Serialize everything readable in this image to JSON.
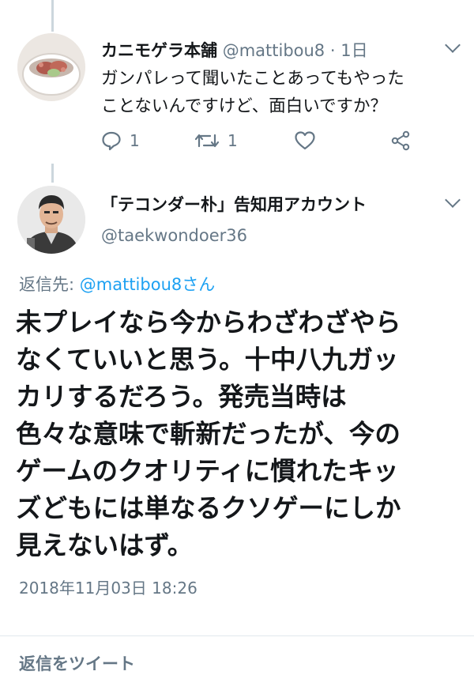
{
  "tweet1": {
    "name": "カニモゲラ本舗",
    "handle": "@mattibou8",
    "separator": " · ",
    "time": "1日",
    "text_line1": "ガンパレって聞いたことあってもやった",
    "text_line2": "ことないんですけど、面白いですか？",
    "reply_count": "1",
    "retweet_count": "1"
  },
  "tweet2": {
    "name": "「テコンダー朴」告知用アカウント",
    "handle": "@taekwondoer36",
    "reply_to_label": "返信先: ",
    "reply_to_handle": "@mattibou8さん",
    "lines": [
      "未プレイなら今からわざわざやら",
      "なくていいと思う。十中八九ガッ",
      "カリするだろう。発売当時は",
      "色々な意味で斬新だったが、今の",
      "ゲームのクオリティに慣れたキッ",
      "ズどもには単なるクソゲーにしか",
      "見えないはず。"
    ],
    "timestamp": "2018年11月03日 18:26"
  },
  "footer": {
    "reply_label": "返信をツイート"
  },
  "colors": {
    "secondary_text": "#657786",
    "link": "#1da1f2",
    "thread_line": "#ccd6dd"
  }
}
